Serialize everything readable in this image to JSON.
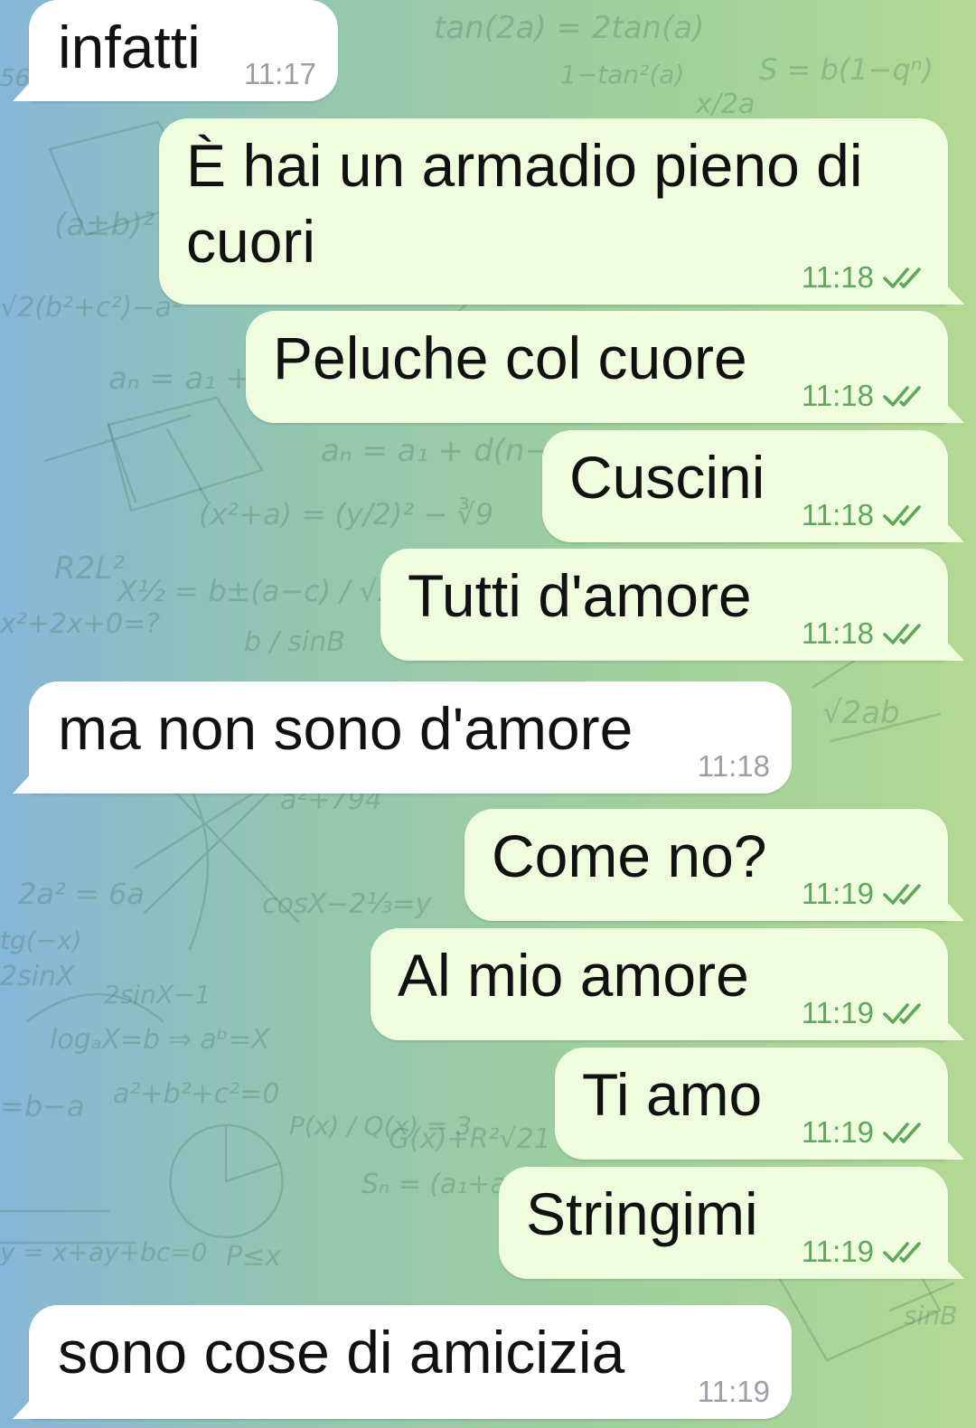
{
  "theme": {
    "incoming_bubble": "#ffffff",
    "outgoing_bubble": "#effdde",
    "outgoing_time_color": "#5da85b",
    "incoming_time_color": "#9aa0a6",
    "check_icon": "double-check-icon"
  },
  "messages": [
    {
      "direction": "incoming",
      "text": "infatti",
      "time": "11:17"
    },
    {
      "direction": "outgoing",
      "text": "È hai un armadio pieno di cuori",
      "time": "11:18",
      "status": "read"
    },
    {
      "direction": "outgoing",
      "text": "Peluche col cuore",
      "time": "11:18",
      "status": "read"
    },
    {
      "direction": "outgoing",
      "text": "Cuscini",
      "time": "11:18",
      "status": "read"
    },
    {
      "direction": "outgoing",
      "text": "Tutti d'amore",
      "time": "11:18",
      "status": "read"
    },
    {
      "direction": "incoming",
      "text": "ma non sono d'amore",
      "time": "11:18"
    },
    {
      "direction": "outgoing",
      "text": "Come no?",
      "time": "11:19",
      "status": "read"
    },
    {
      "direction": "outgoing",
      "text": "Al mio amore",
      "time": "11:19",
      "status": "read"
    },
    {
      "direction": "outgoing",
      "text": "Ti amo",
      "time": "11:19",
      "status": "read"
    },
    {
      "direction": "outgoing",
      "text": "Stringimi",
      "time": "11:19",
      "status": "read"
    },
    {
      "direction": "incoming",
      "text": "sono cose di amicizia",
      "time": "11:19"
    }
  ]
}
